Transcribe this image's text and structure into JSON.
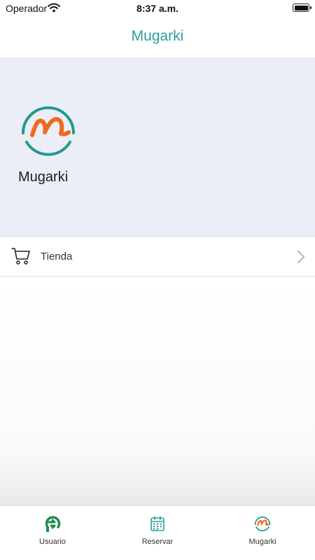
{
  "status_bar": {
    "carrier": "Operador",
    "time": "8:37 a.m."
  },
  "nav": {
    "title": "Mugarki"
  },
  "profile": {
    "name": "Mugarki"
  },
  "list": {
    "items": [
      {
        "label": "Tienda",
        "icon": "cart-icon"
      }
    ]
  },
  "tabs": [
    {
      "label": "Usuario",
      "icon": "user-logo-icon"
    },
    {
      "label": "Reservar",
      "icon": "calendar-icon"
    },
    {
      "label": "Mugarki",
      "icon": "mugarki-logo-icon",
      "selected": true
    }
  ],
  "colors": {
    "accent": "#2b9fa0",
    "brand_orange": "#ee6a1f",
    "brand_teal": "#229a8f",
    "header_bg": "#ebeef6"
  }
}
